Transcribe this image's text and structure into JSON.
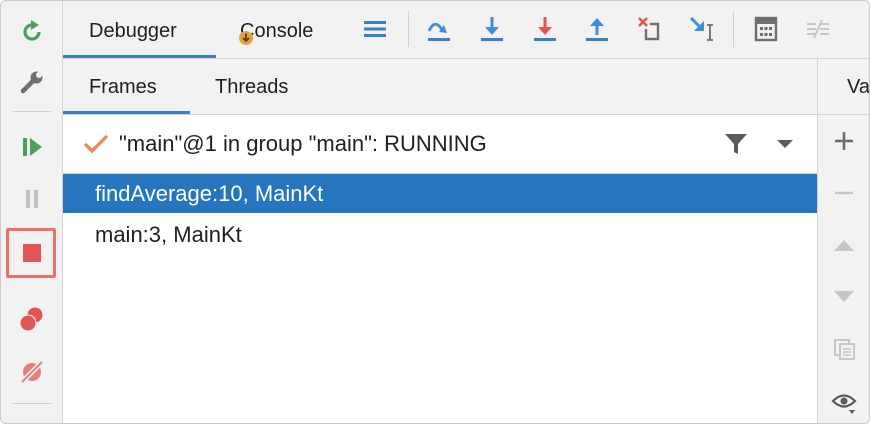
{
  "main_tabs": [
    {
      "label": "Debugger",
      "active": true
    },
    {
      "label": "Console",
      "active": false
    }
  ],
  "sub_tabs": [
    {
      "label": "Frames",
      "active": true
    },
    {
      "label": "Threads",
      "active": false
    }
  ],
  "thread": {
    "label": "\"main\"@1 in group \"main\": RUNNING"
  },
  "frames": [
    {
      "label": "findAverage:10, MainKt",
      "selected": true
    },
    {
      "label": "main:3, MainKt",
      "selected": false
    }
  ],
  "right_panel": {
    "header_partial": "Va"
  },
  "colors": {
    "accent": "#3d7cc9",
    "selection": "#2675bf",
    "stop": "#e05555",
    "resume": "#4aa05a",
    "rerun": "#4aa05a"
  },
  "icons": {
    "left_toolbar": [
      "rerun-icon",
      "settings-wrench-icon",
      "resume-icon",
      "pause-icon",
      "stop-icon",
      "view-breakpoints-icon",
      "mute-breakpoints-icon"
    ],
    "top_toolbar": [
      "layout-menu-icon",
      "step-over-icon",
      "step-into-icon",
      "force-step-into-icon",
      "step-out-icon",
      "drop-frame-icon",
      "run-to-cursor-icon",
      "evaluate-expression-icon",
      "trace-icon"
    ],
    "right_panel": [
      "add-icon",
      "remove-icon",
      "move-up-icon",
      "move-down-icon",
      "copy-icon",
      "watch-eye-icon"
    ]
  }
}
